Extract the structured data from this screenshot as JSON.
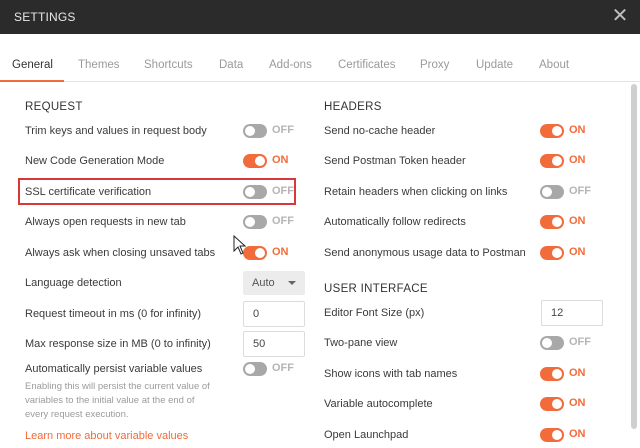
{
  "window": {
    "title": "SETTINGS",
    "close_icon": "close-icon"
  },
  "tabs": [
    "General",
    "Themes",
    "Shortcuts",
    "Data",
    "Add-ons",
    "Certificates",
    "Proxy",
    "Update",
    "About"
  ],
  "active_tab": "General",
  "colors": {
    "accent": "#f26b3a",
    "toggle_off": "#a8a8a8",
    "highlight": "#d8383c",
    "titlebar": "#2b2b2b"
  },
  "request": {
    "title": "REQUEST",
    "trim_keys": {
      "label": "Trim keys and values in request body",
      "state": "OFF"
    },
    "new_codegen": {
      "label": "New Code Generation Mode",
      "state": "ON"
    },
    "ssl_verification": {
      "label": "SSL certificate verification",
      "state": "OFF"
    },
    "open_new_tab": {
      "label": "Always open requests in new tab",
      "state": "OFF"
    },
    "ask_closing": {
      "label": "Always ask when closing unsaved tabs",
      "state": "ON"
    },
    "language_detection": {
      "label": "Language detection",
      "value": "Auto"
    },
    "timeout": {
      "label": "Request timeout in ms (0 for infinity)",
      "value": "0"
    },
    "max_response": {
      "label": "Max response size in MB (0 to infinity)",
      "value": "50"
    },
    "persist_vars": {
      "label": "Automatically persist variable values",
      "state": "OFF",
      "desc1": "Enabling this will persist the current value of",
      "desc2": "variables to the initial value at the end of",
      "desc3": "every request execution.",
      "link": "Learn more about variable values"
    }
  },
  "headers": {
    "title": "HEADERS",
    "no_cache": {
      "label": "Send no-cache header",
      "state": "ON"
    },
    "postman_token": {
      "label": "Send Postman Token header",
      "state": "ON"
    },
    "retain_headers": {
      "label": "Retain headers when clicking on links",
      "state": "OFF"
    },
    "follow_redirects": {
      "label": "Automatically follow redirects",
      "state": "ON"
    },
    "usage_data": {
      "label": "Send anonymous usage data to Postman",
      "state": "ON"
    }
  },
  "ui": {
    "title": "USER INTERFACE",
    "font_size": {
      "label": "Editor Font Size (px)",
      "value": "12"
    },
    "two_pane": {
      "label": "Two-pane view",
      "state": "OFF"
    },
    "show_icons": {
      "label": "Show icons with tab names",
      "state": "ON"
    },
    "var_autocomplete": {
      "label": "Variable autocomplete",
      "state": "ON"
    },
    "launchpad": {
      "label": "Open Launchpad",
      "state": "ON"
    }
  }
}
